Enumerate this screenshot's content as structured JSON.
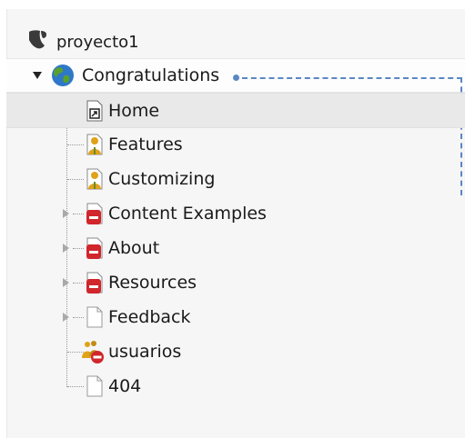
{
  "tree": {
    "root": {
      "label": "proyecto1",
      "icon": "typo3-logo-icon"
    },
    "site": {
      "label": "Congratulations",
      "icon": "globe-icon",
      "expanded": true
    },
    "pages": [
      {
        "label": "Home",
        "icon": "shortcut-page-icon",
        "selected": true,
        "has_children": false
      },
      {
        "label": "Features",
        "icon": "user-page-icon",
        "has_children": false
      },
      {
        "label": "Customizing",
        "icon": "user-page-icon",
        "has_children": false
      },
      {
        "label": "Content Examples",
        "icon": "restricted-page-icon",
        "has_children": true
      },
      {
        "label": "About",
        "icon": "restricted-page-icon",
        "has_children": true
      },
      {
        "label": "Resources",
        "icon": "restricted-page-icon",
        "has_children": true
      },
      {
        "label": "Feedback",
        "icon": "page-icon",
        "has_children": true
      },
      {
        "label": "usuarios",
        "icon": "folder-group-icon",
        "has_children": false
      },
      {
        "label": "404",
        "icon": "page-icon",
        "has_children": false
      }
    ]
  },
  "colors": {
    "drag_indicator": "#5a87c4",
    "restricted_badge": "#d0262c",
    "globe_blue": "#2e78c7",
    "globe_green": "#5aa02c",
    "user_body": "#e0a21a"
  }
}
